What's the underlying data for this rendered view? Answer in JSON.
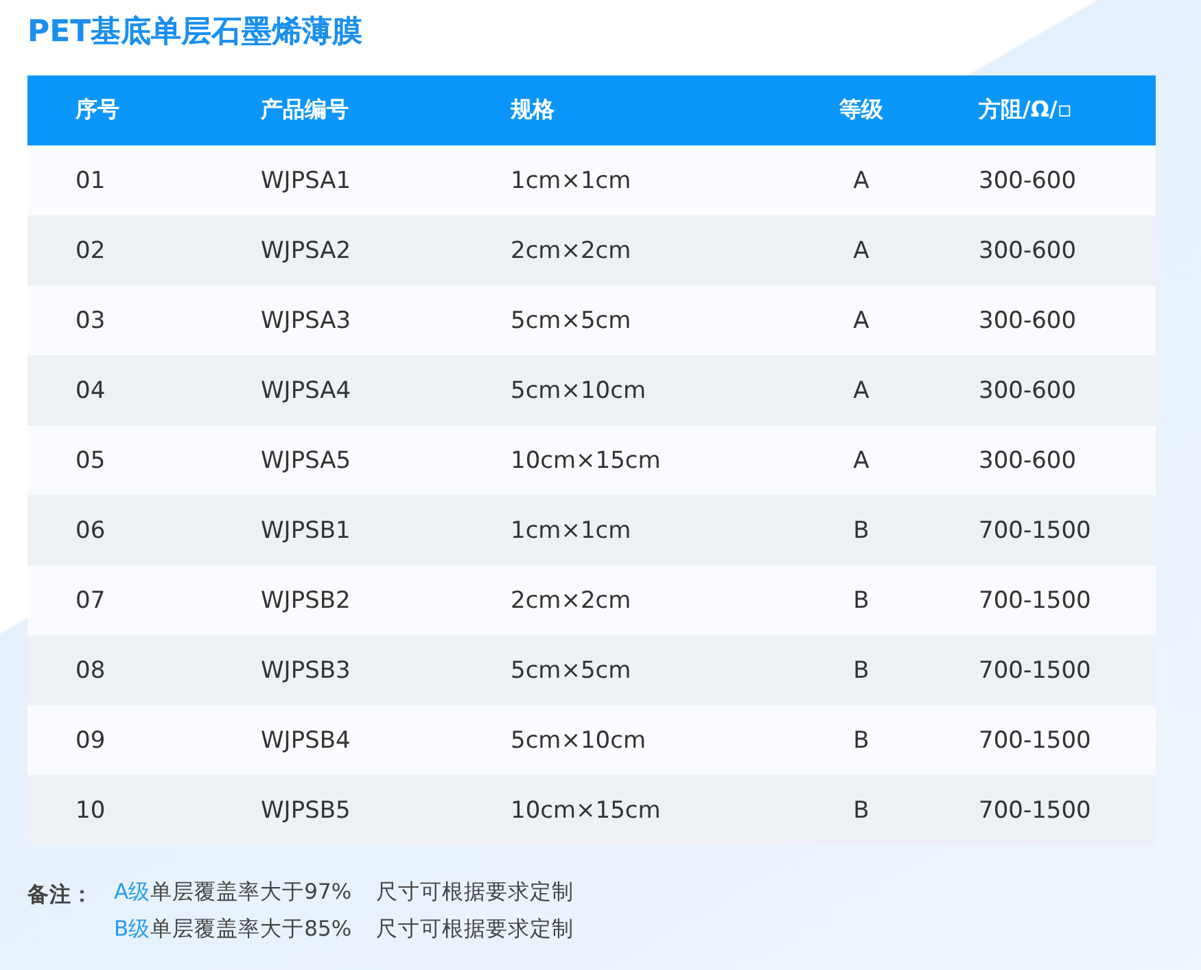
{
  "title": "PET基底单层石墨烯薄膜",
  "table": {
    "columns": [
      "序号",
      "产品编号",
      "规格",
      "等级",
      "方阻/Ω/▫"
    ],
    "rows": [
      [
        "01",
        "WJPSA1",
        "1cm×1cm",
        "A",
        "300-600"
      ],
      [
        "02",
        "WJPSA2",
        "2cm×2cm",
        "A",
        "300-600"
      ],
      [
        "03",
        "WJPSA3",
        "5cm×5cm",
        "A",
        "300-600"
      ],
      [
        "04",
        "WJPSA4",
        "5cm×10cm",
        "A",
        "300-600"
      ],
      [
        "05",
        "WJPSA5",
        "10cm×15cm",
        "A",
        "300-600"
      ],
      [
        "06",
        "WJPSB1",
        "1cm×1cm",
        "B",
        "700-1500"
      ],
      [
        "07",
        "WJPSB2",
        "2cm×2cm",
        "B",
        "700-1500"
      ],
      [
        "08",
        "WJPSB3",
        "5cm×5cm",
        "B",
        "700-1500"
      ],
      [
        "09",
        "WJPSB4",
        "5cm×10cm",
        "B",
        "700-1500"
      ],
      [
        "10",
        "WJPSB5",
        "10cm×15cm",
        "B",
        "700-1500"
      ]
    ]
  },
  "notes": {
    "label": "备注：",
    "lines": [
      {
        "grade": "A级",
        "coverage": "单层覆盖率大于97%",
        "size": "尺寸可根据要求定制"
      },
      {
        "grade": "B级",
        "coverage": "单层覆盖率大于85%",
        "size": "尺寸可根据要求定制"
      }
    ]
  }
}
